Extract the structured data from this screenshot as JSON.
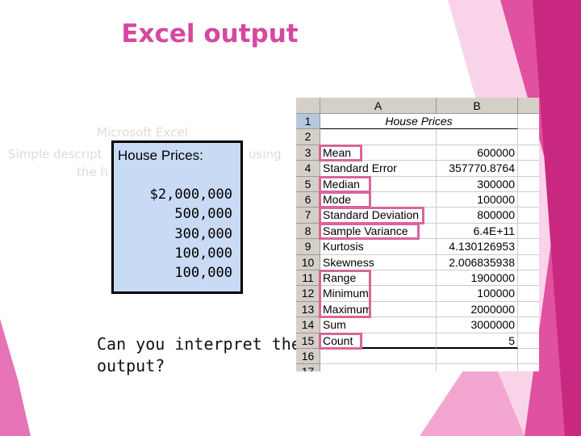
{
  "slide": {
    "title": "Excel output",
    "faded_text": {
      "line1": "Microsoft Excel",
      "line2_left": "Simple descript",
      "line2_right": "using",
      "line3": "the h"
    },
    "house_box": {
      "header": "House Prices:",
      "prices": [
        "$2,000,000",
        "500,000",
        "300,000",
        "100,000",
        "100,000"
      ]
    },
    "question": [
      "Can you interpret the",
      "output?"
    ],
    "colors": {
      "accent": "#d6489f",
      "box_bg": "#c9daf5",
      "highlight": "#d8669a"
    }
  },
  "sheet": {
    "columns": [
      "A",
      "B"
    ],
    "title": "House Prices",
    "rows": [
      {
        "n": "1"
      },
      {
        "n": "2"
      },
      {
        "n": "3",
        "label": "Mean",
        "value": "600000",
        "hl": true
      },
      {
        "n": "4",
        "label": "Standard Error",
        "value": "357770.8764"
      },
      {
        "n": "5",
        "label": "Median",
        "value": "300000",
        "hl": true
      },
      {
        "n": "6",
        "label": "Mode",
        "value": "100000",
        "hl": true
      },
      {
        "n": "7",
        "label": "Standard Deviation",
        "value": "800000",
        "hl": true
      },
      {
        "n": "8",
        "label": "Sample Variance",
        "value": "6.4E+11",
        "hl": true
      },
      {
        "n": "9",
        "label": "Kurtosis",
        "value": "4.130126953"
      },
      {
        "n": "10",
        "label": "Skewness",
        "value": "2.006835938"
      },
      {
        "n": "11",
        "label": "Range",
        "value": "1900000",
        "hl": true
      },
      {
        "n": "12",
        "label": "Minimum",
        "value": "100000",
        "hl": true
      },
      {
        "n": "13",
        "label": "Maximum",
        "value": "2000000",
        "hl": true
      },
      {
        "n": "14",
        "label": "Sum",
        "value": "3000000"
      },
      {
        "n": "15",
        "label": "Count",
        "value": "5",
        "hl": true
      },
      {
        "n": "16"
      },
      {
        "n": "17"
      }
    ]
  }
}
